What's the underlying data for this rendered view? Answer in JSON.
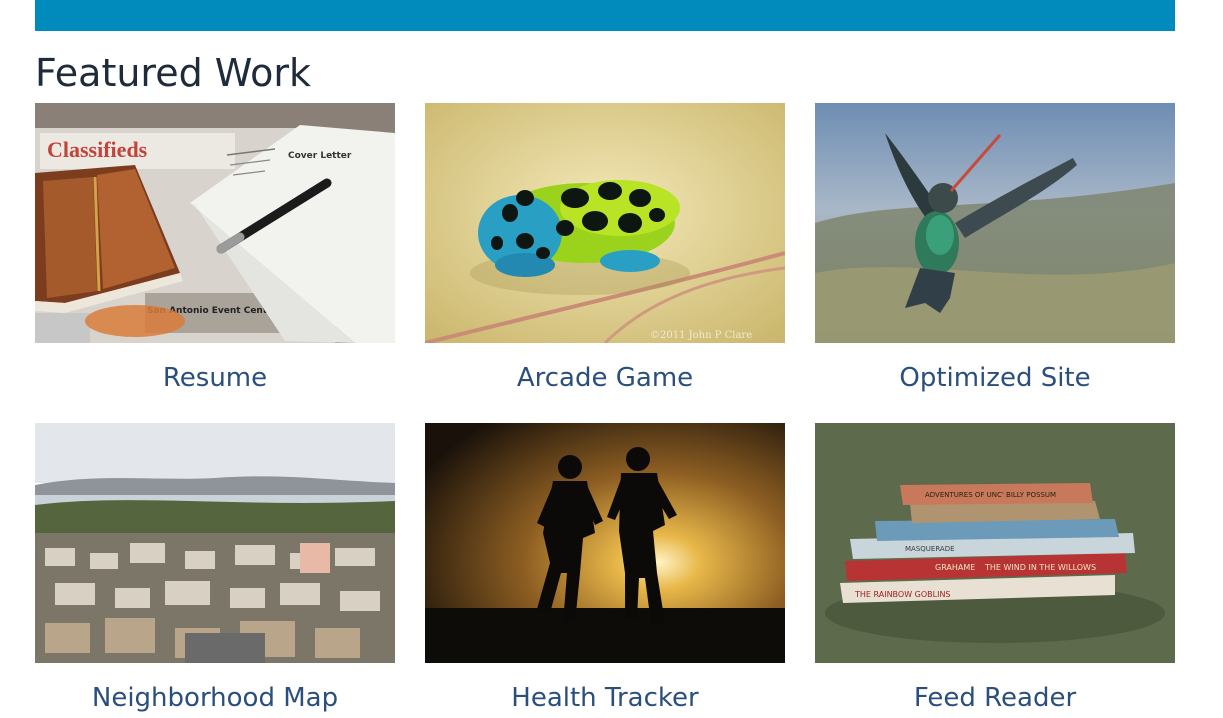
{
  "header": {
    "accent_color": "#008bbd"
  },
  "section": {
    "title": "Featured Work"
  },
  "projects": [
    {
      "title": "Resume",
      "image": "classifieds-cover-letter-photo"
    },
    {
      "title": "Arcade Game",
      "image": "poison-dart-frog-photo"
    },
    {
      "title": "Optimized Site",
      "image": "hummingbird-photo"
    },
    {
      "title": "Neighborhood Map",
      "image": "city-aerial-photo"
    },
    {
      "title": "Health Tracker",
      "image": "runners-silhouette-photo"
    },
    {
      "title": "Feed Reader",
      "image": "stacked-books-photo"
    }
  ],
  "images": {
    "newspaper_heading": "Classifieds",
    "letter_heading": "Cover Letter",
    "frog_credit": "©2011 John P Clare",
    "newspaper_snippet": "San Antonio Event Cent",
    "book_titles": [
      "ADVENTURES OF UNC' BILLY POSSUM",
      "THE WIND IN THE WILLOWS",
      "MASQUERADE",
      "GRAHAME",
      "THE RAINBOW GOBLINS"
    ]
  }
}
